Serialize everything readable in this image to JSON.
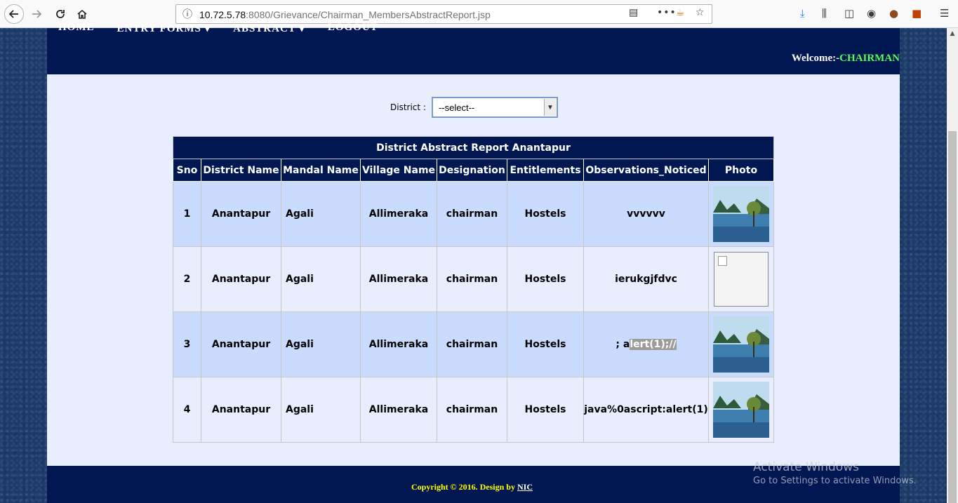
{
  "browser": {
    "url_host": "10.72.5.78",
    "url_rest": ":8080/Grievance/Chairman_MembersAbstractReport.jsp"
  },
  "header": {
    "menu": [
      "HOME",
      "ENTRY FORMS ▾",
      "ABSTRACT ▾",
      "LOGOUT"
    ],
    "welcome_label": "Welcome:-",
    "welcome_user": "CHAIRMAN"
  },
  "filter": {
    "district_label": "District :",
    "district_value": "--select--"
  },
  "report": {
    "title": "District Abstract Report Anantapur",
    "columns": [
      "Sno",
      "District Name",
      "Mandal Name",
      "Village Name",
      "Designation",
      "Entitlements",
      "Observations_Noticed",
      "Photo"
    ],
    "rows": [
      {
        "sno": "1",
        "district": "Anantapur",
        "mandal": "Agali",
        "village": "Allimeraka",
        "designation": "chairman",
        "entitlements": "Hostels",
        "observations": "vvvvvv"
      },
      {
        "sno": "2",
        "district": "Anantapur",
        "mandal": "Agali",
        "village": "Allimeraka",
        "designation": "chairman",
        "entitlements": "Hostels",
        "observations": "ierukgjfdvc"
      },
      {
        "sno": "3",
        "district": "Anantapur",
        "mandal": "Agali",
        "village": "Allimeraka",
        "designation": "chairman",
        "entitlements": "Hostels",
        "observations_a": "; a",
        "observations_b": "lert(1);//"
      },
      {
        "sno": "4",
        "district": "Anantapur",
        "mandal": "Agali",
        "village": "Allimeraka",
        "designation": "chairman",
        "entitlements": "Hostels",
        "observations": "java%0ascript:alert(1)"
      }
    ]
  },
  "footer": {
    "copyright": "Copyright © 2016. Design by ",
    "link": "NIC"
  },
  "watermark": {
    "title": "Activate Windows",
    "subtitle": "Go to Settings to activate Windows."
  }
}
